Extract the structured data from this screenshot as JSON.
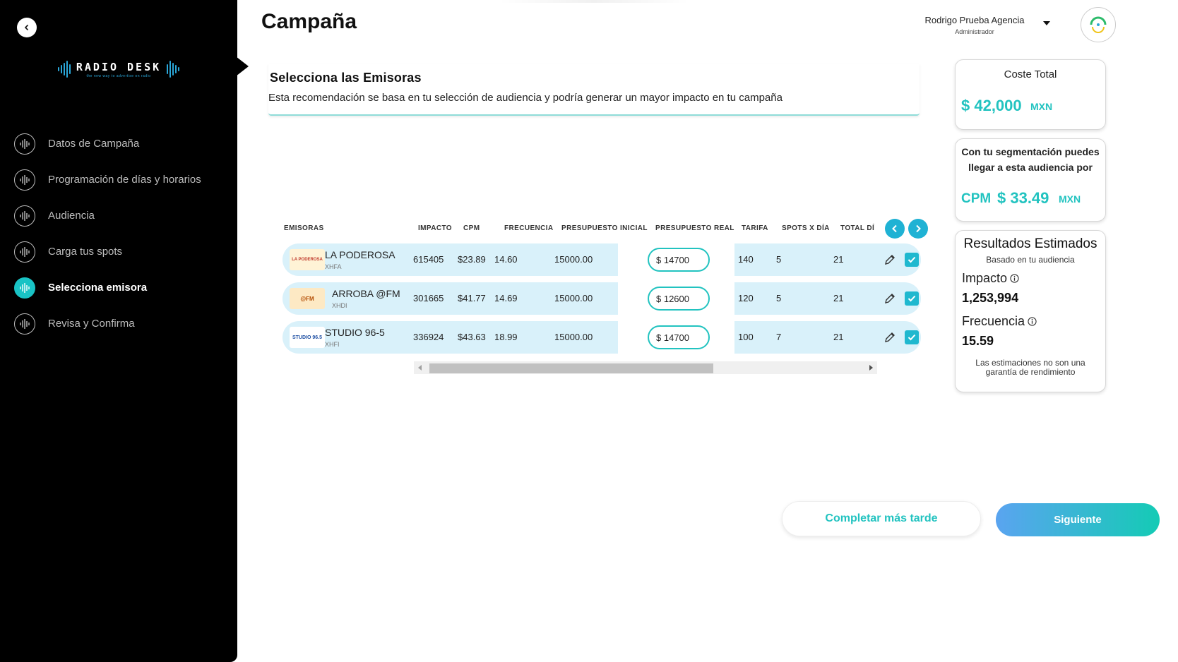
{
  "sidebar": {
    "logo": {
      "title": "RADIO DESK",
      "subtitle": "the new way to advertise on radio"
    },
    "items": [
      {
        "label": "Datos de Campaña",
        "active": false
      },
      {
        "label": "Programación de días y horarios",
        "active": false
      },
      {
        "label": "Audiencia",
        "active": false
      },
      {
        "label": "Carga tus spots",
        "active": false
      },
      {
        "label": "Selecciona emisora",
        "active": true
      },
      {
        "label": "Revisa y Confirma",
        "active": false
      }
    ]
  },
  "header": {
    "title": "Campaña",
    "user_name": "Rodrigo Prueba Agencia",
    "user_role": "Administrador"
  },
  "section": {
    "title": "Selecciona las Emisoras",
    "description": "Esta recomendación se basa en tu selección de audiencia y podría generar un mayor impacto en tu campaña"
  },
  "table": {
    "columns": [
      "EMISORAS",
      "IMPACTO",
      "CPM",
      "FRECUENCIA",
      "PRESUPUESTO INICIAL",
      "PRESUPUESTO REAL",
      "TARIFA",
      "SPOTS X DÍA",
      "TOTAL DÍ"
    ],
    "rows": [
      {
        "name": "LA PODEROSA",
        "code": "XHFA",
        "impacto": "615405",
        "cpm": "$23.89",
        "frecuencia": "14.60",
        "presupuesto_inicial": "15000.00",
        "presupuesto_real": "$ 14700",
        "tarifa": "140",
        "spots": "5",
        "total_dias": "21",
        "logo_text": "LA PODEROSA",
        "selected": true
      },
      {
        "name": "ARROBA @FM",
        "code": "XHDI",
        "impacto": "301665",
        "cpm": "$41.77",
        "frecuencia": "14.69",
        "presupuesto_inicial": "15000.00",
        "presupuesto_real": "$ 12600",
        "tarifa": "120",
        "spots": "5",
        "total_dias": "21",
        "logo_text": "@FM",
        "selected": true
      },
      {
        "name": "STUDIO 96-5",
        "code": "XHFI",
        "impacto": "336924",
        "cpm": "$43.63",
        "frecuencia": "18.99",
        "presupuesto_inicial": "15000.00",
        "presupuesto_real": "$ 14700",
        "tarifa": "100",
        "spots": "7",
        "total_dias": "21",
        "logo_text": "STUDIO 96.5",
        "selected": true
      }
    ]
  },
  "cost_card": {
    "label": "Coste Total",
    "amount": "$ 42,000",
    "currency": "MXN"
  },
  "cpm_card": {
    "line1": "Con tu segmentación puedes",
    "line2": "llegar a esta audiencia por",
    "label": "CPM",
    "amount": "$ 33.49",
    "currency": "MXN"
  },
  "results_card": {
    "title": "Resultados Estimados",
    "subtitle": "Basado en tu audiencia",
    "impacto_label": "Impacto",
    "impacto_value": "1,253,994",
    "frecuencia_label": "Frecuencia",
    "frecuencia_value": "15.59",
    "note_line1": "Las estimaciones no son una",
    "note_line2": "garantía de rendimiento"
  },
  "buttons": {
    "later": "Completar más tarde",
    "next": "Siguiente"
  },
  "colors": {
    "accent": "#22c3c0",
    "row_bg": "#d9f1fa",
    "arrow": "#1fb2d4",
    "sidebar_bg": "#000000"
  }
}
